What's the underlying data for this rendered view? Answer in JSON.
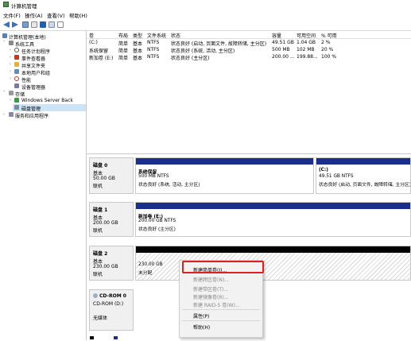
{
  "window": {
    "title": "计算机管理"
  },
  "menu": {
    "items": [
      "文件(F)",
      "操作(A)",
      "查看(V)",
      "帮助(H)"
    ]
  },
  "toolbar": {
    "buttons": [
      "back-icon",
      "forward-icon",
      "up-icon",
      "properties-icon",
      "help-icon",
      "view-icon",
      "refresh-icon"
    ]
  },
  "tree": {
    "items": [
      {
        "label": "计算机管理(本地)"
      },
      {
        "label": "系统工具"
      },
      {
        "label": "任务计划程序"
      },
      {
        "label": "事件查看器"
      },
      {
        "label": "共享文件夹"
      },
      {
        "label": "本地用户和组"
      },
      {
        "label": "性能"
      },
      {
        "label": "设备管理器"
      },
      {
        "label": "存储"
      },
      {
        "label": "Windows Server Back"
      },
      {
        "label": "磁盘管理"
      },
      {
        "label": "服务和应用程序"
      }
    ]
  },
  "volumes": {
    "headers": [
      "卷",
      "布局",
      "类型",
      "文件系统",
      "状态",
      "容量",
      "可用空间",
      "% 可用"
    ],
    "rows": [
      [
        "(C:)",
        "简单",
        "基本",
        "NTFS",
        "状态良好 (启动, 页面文件, 故障转储, 主分区)",
        "49.51 GB",
        "1.04 GB",
        "2 %"
      ],
      [
        "系统保留",
        "简单",
        "基本",
        "NTFS",
        "状态良好 (系统, 活动, 主分区)",
        "500 MB",
        "102 MB",
        "20 %"
      ],
      [
        "新加卷 (E:)",
        "简单",
        "基本",
        "NTFS",
        "状态良好 (主分区)",
        "200.00 ...",
        "199.88...",
        "100 %"
      ]
    ]
  },
  "disks": [
    {
      "name": "磁盘 0",
      "type": "基本",
      "size": "50.00 GB",
      "status": "联机",
      "parts": [
        {
          "name": "系统保留",
          "size": "500 MB NTFS",
          "status": "状态良好 (系统, 活动, 主分区)"
        },
        {
          "name": "(C:)",
          "size": "49.51 GB NTFS",
          "status": "状态良好 (启动, 页面文件, 故障转储, 主分区)"
        }
      ]
    },
    {
      "name": "磁盘 1",
      "type": "基本",
      "size": "200.00 GB",
      "status": "联机",
      "parts": [
        {
          "name": "新加卷 (E:)",
          "size": "200.00 GB NTFS",
          "status": "状态良好 (主分区)"
        }
      ]
    },
    {
      "name": "磁盘 2",
      "type": "基本",
      "size": "230.00 GB",
      "status": "联机",
      "parts": [
        {
          "name": "",
          "size": "230.00 GB",
          "status": "未分配"
        }
      ]
    },
    {
      "name": "CD-ROM 0",
      "type": "CD-ROM (D:)",
      "size": "",
      "status": "无媒体"
    }
  ],
  "context_menu": {
    "items": [
      {
        "label": "新建简单卷(I)...",
        "enabled": true
      },
      {
        "label": "新建跨区卷(N)...",
        "enabled": false
      },
      {
        "label": "新建带区卷(T)...",
        "enabled": false
      },
      {
        "label": "新建镜像卷(R)...",
        "enabled": false
      },
      {
        "label": "新建 RAID-5 卷(W)...",
        "enabled": false
      },
      {
        "label": "属性(P)",
        "enabled": true
      },
      {
        "label": "帮助(H)",
        "enabled": true
      }
    ]
  },
  "colors": {
    "primary_partition": "#1a2f8c",
    "unallocated": "#000000",
    "highlight": "#e02020"
  }
}
